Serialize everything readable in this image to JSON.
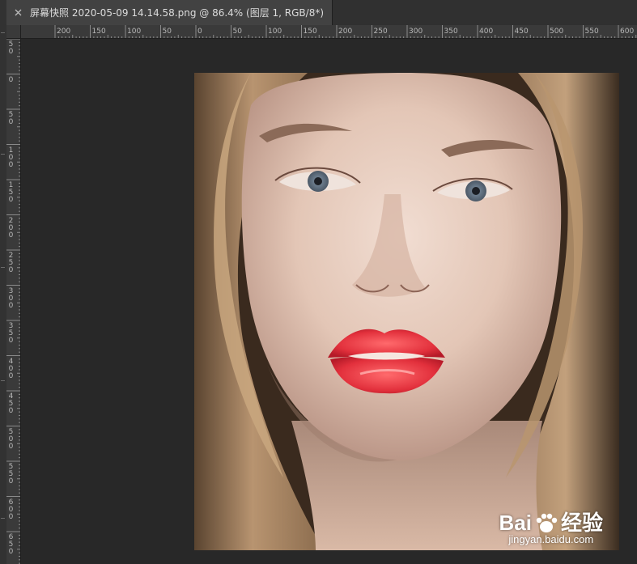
{
  "document": {
    "tab_title": "屏幕快照 2020-05-09 14.14.58.png @ 86.4% (图层 1, RGB/8*)",
    "close_icon": "close-icon"
  },
  "ruler_h": {
    "labels": [
      "200",
      "150",
      "100",
      "50",
      "0",
      "50",
      "100",
      "150",
      "200",
      "250",
      "300",
      "350",
      "400",
      "450",
      "500",
      "550",
      "600"
    ]
  },
  "ruler_v": {
    "labels": [
      "50",
      "0",
      "50",
      "100",
      "150",
      "200",
      "250",
      "300",
      "350",
      "400",
      "450",
      "500",
      "550",
      "600",
      "650"
    ]
  },
  "watermark": {
    "brand_prefix": "Bai",
    "brand_suffix": "经验",
    "url": "jingyan.baidu.com"
  },
  "colors": {
    "workspace": "#282828",
    "ruler": "#3a3a3a",
    "tab_active": "#424242",
    "lip_red": "#e0303c"
  }
}
